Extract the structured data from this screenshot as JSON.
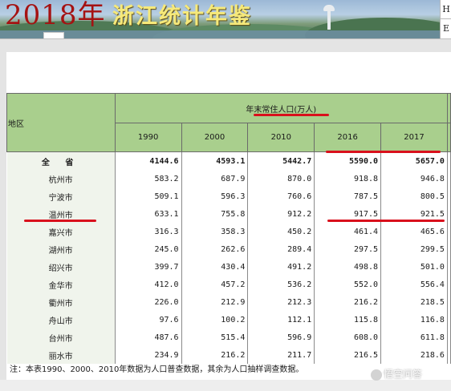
{
  "header": {
    "year": "2018年",
    "title": "浙江统计年鉴",
    "side_buttons": [
      "H",
      "E"
    ]
  },
  "table": {
    "region_header": "地区",
    "group_header": "年末常住人口(万人)",
    "years": [
      "1990",
      "2000",
      "2010",
      "2016",
      "2017"
    ],
    "rows": [
      {
        "name": "全 省",
        "values": [
          "4144.6",
          "4593.1",
          "5442.7",
          "5590.0",
          "5657.0"
        ]
      },
      {
        "name": "杭州市",
        "values": [
          "583.2",
          "687.9",
          "870.0",
          "918.8",
          "946.8"
        ]
      },
      {
        "name": "宁波市",
        "values": [
          "509.1",
          "596.3",
          "760.6",
          "787.5",
          "800.5"
        ]
      },
      {
        "name": "温州市",
        "values": [
          "633.1",
          "755.8",
          "912.2",
          "917.5",
          "921.5"
        ]
      },
      {
        "name": "嘉兴市",
        "values": [
          "316.3",
          "358.3",
          "450.2",
          "461.4",
          "465.6"
        ]
      },
      {
        "name": "湖州市",
        "values": [
          "245.0",
          "262.6",
          "289.4",
          "297.5",
          "299.5"
        ]
      },
      {
        "name": "绍兴市",
        "values": [
          "399.7",
          "430.4",
          "491.2",
          "498.8",
          "501.0"
        ]
      },
      {
        "name": "金华市",
        "values": [
          "412.0",
          "457.2",
          "536.2",
          "552.0",
          "556.4"
        ]
      },
      {
        "name": "衢州市",
        "values": [
          "226.0",
          "212.9",
          "212.3",
          "216.2",
          "218.5"
        ]
      },
      {
        "name": "舟山市",
        "values": [
          "97.6",
          "100.2",
          "112.1",
          "115.8",
          "116.8"
        ]
      },
      {
        "name": "台州市",
        "values": [
          "487.6",
          "515.4",
          "596.9",
          "608.0",
          "611.8"
        ]
      },
      {
        "name": "丽水市",
        "values": [
          "234.9",
          "216.2",
          "211.7",
          "216.5",
          "218.6"
        ]
      }
    ]
  },
  "note": "注：本表1990、2000、2010年数据为人口普查数据，其余为人口抽样调查数据。",
  "watermark": "悟空问答",
  "colors": {
    "header_green": "#a9cf8d",
    "highlight_red": "#d9101c",
    "year_red": "#a51212",
    "title_yellow": "#f6e97a"
  }
}
